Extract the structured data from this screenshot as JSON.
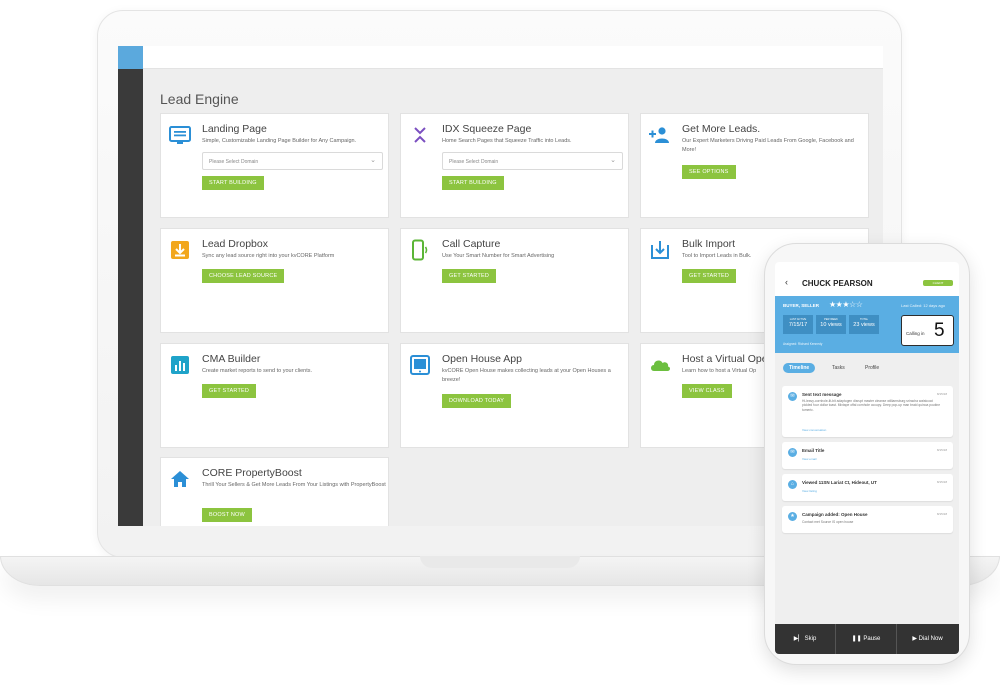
{
  "app": {
    "page_title": "Lead Engine"
  },
  "cards": [
    {
      "title": "Landing Page",
      "desc": "Simple, Customizable Landing Page Builder for Any Campaign.",
      "select_placeholder": "Please Select Domain",
      "button": "START BUILDING",
      "icon": "landing-page-icon"
    },
    {
      "title": "IDX Squeeze Page",
      "desc": "Home Search Pages that Squeeze Traffic into Leads.",
      "select_placeholder": "Please Select Domain",
      "button": "START BUILDING",
      "icon": "chevron-squeeze-icon"
    },
    {
      "title": "Get More Leads.",
      "desc": "Our Expert Marketers Driving Paid Leads From Google, Facebook and More!",
      "button": "SEE OPTIONS",
      "icon": "add-users-icon"
    },
    {
      "title": "Lead Dropbox",
      "desc": "Sync any lead source right into your kvCORE Platform",
      "button": "CHOOSE LEAD SOURCE",
      "icon": "dropbox-download-icon"
    },
    {
      "title": "Call Capture",
      "desc": "Use Your Smart Number for Smart Advertising",
      "button": "GET STARTED",
      "icon": "phone-icon"
    },
    {
      "title": "Bulk Import",
      "desc": "Tool to Import Leads in Bulk.",
      "button": "GET STARTED",
      "icon": "import-icon"
    },
    {
      "title": "CMA Builder",
      "desc": "Create market reports to send to your clients.",
      "button": "GET STARTED",
      "icon": "bar-chart-icon"
    },
    {
      "title": "Open House App",
      "desc": "kvCORE Open House makes collecting leads at your Open Houses a breeze!",
      "button": "DOWNLOAD TODAY",
      "icon": "tablet-icon"
    },
    {
      "title": "Host a Virtual Ope",
      "desc": "Learn how to host a Virtual Op",
      "button": "VIEW CLASS",
      "icon": "cloud-icon"
    },
    {
      "title": "CORE PropertyBoost",
      "desc": "Thrill Your Sellers & Get More Leads From Your Listings with PropertyBoost",
      "button": "BOOST NOW",
      "icon": "house-icon"
    }
  ],
  "phone": {
    "back": "‹",
    "name": "CHUCK PEARSON",
    "badge": "CLIENT",
    "role": "BUYER, SELLER",
    "stars": "★★★☆☆",
    "last_called": "Last Called: 12 days ago",
    "stats": [
      {
        "label": "LAST ACTIVE",
        "value": "7/15/17"
      },
      {
        "label": "PER WEEK",
        "value": "10 views"
      },
      {
        "label": "TOTAL",
        "value": "23 views"
      }
    ],
    "assigned": "Assigned: Richard Kennedy",
    "calling_label": "Calling in",
    "calling_count": "5",
    "tabs": [
      "Timeline",
      "Tasks",
      "Profile"
    ],
    "feed": [
      {
        "title": "Sent text message",
        "date": "8/15/18",
        "body": "Hi-leavy-cornhole-lit-bit adaptogen disrupt master cleanse williamsburg sriracha waistcoat pickled four dollar toast. Mixtape offal cornhole occupy. Deep pop-up man braid quinoa poutine tumeric.",
        "link": "View conversation"
      },
      {
        "title": "Email Title",
        "date": "8/15/18",
        "body": "",
        "link": "View email"
      },
      {
        "title": "Viewed 11SN Lariat Ct, Hideout, UT",
        "date": "8/15/18",
        "body": "",
        "link": "View listing"
      },
      {
        "title": "Campaign added: Open House",
        "date": "8/15/18",
        "body": "Contact met Source IS open house",
        "link": ""
      }
    ],
    "footer": [
      "Skip",
      "Pause",
      "Dial Now"
    ]
  }
}
